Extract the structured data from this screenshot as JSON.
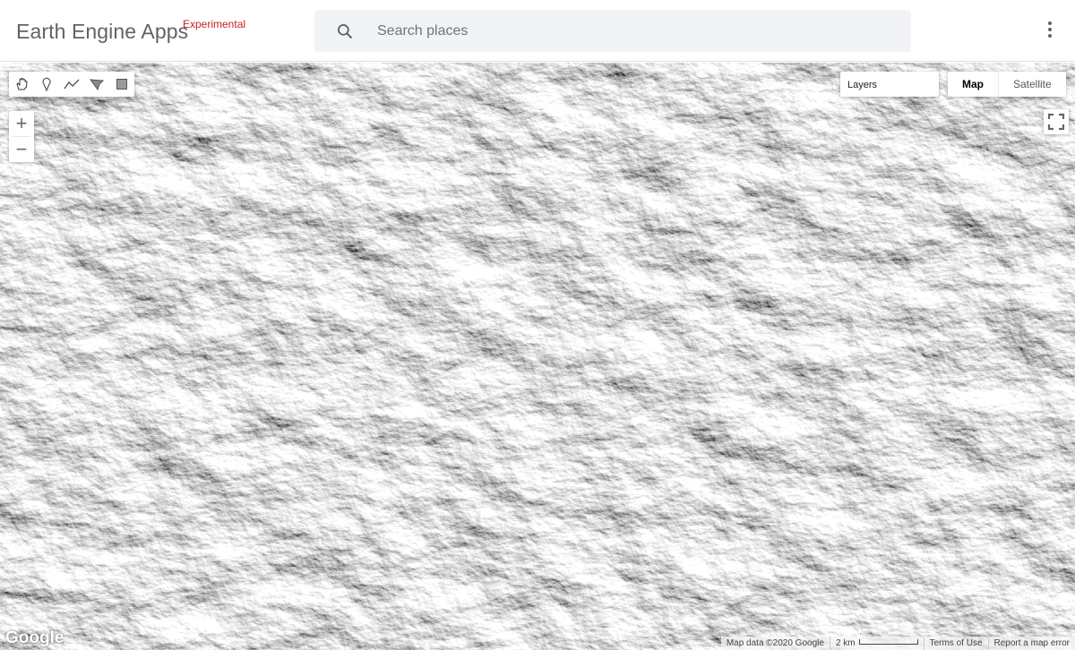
{
  "header": {
    "title": "Earth Engine Apps",
    "badge": "Experimental",
    "search_placeholder": "Search places"
  },
  "map": {
    "layers_label": "Layers",
    "map_type_options": [
      "Map",
      "Satellite"
    ],
    "selected_map_type": "Map",
    "zoom_in": "+",
    "zoom_out": "−",
    "logo": "Google",
    "attribution": {
      "map_data": "Map data ©2020 Google",
      "scale": "2 km",
      "terms": "Terms of Use",
      "report": "Report a map error"
    },
    "draw_tools": [
      "hand-icon",
      "marker-icon",
      "line-icon",
      "polygon-icon",
      "rectangle-icon"
    ]
  },
  "colors": {
    "accent": "#c5221f",
    "search_bg": "#f1f3f4"
  }
}
